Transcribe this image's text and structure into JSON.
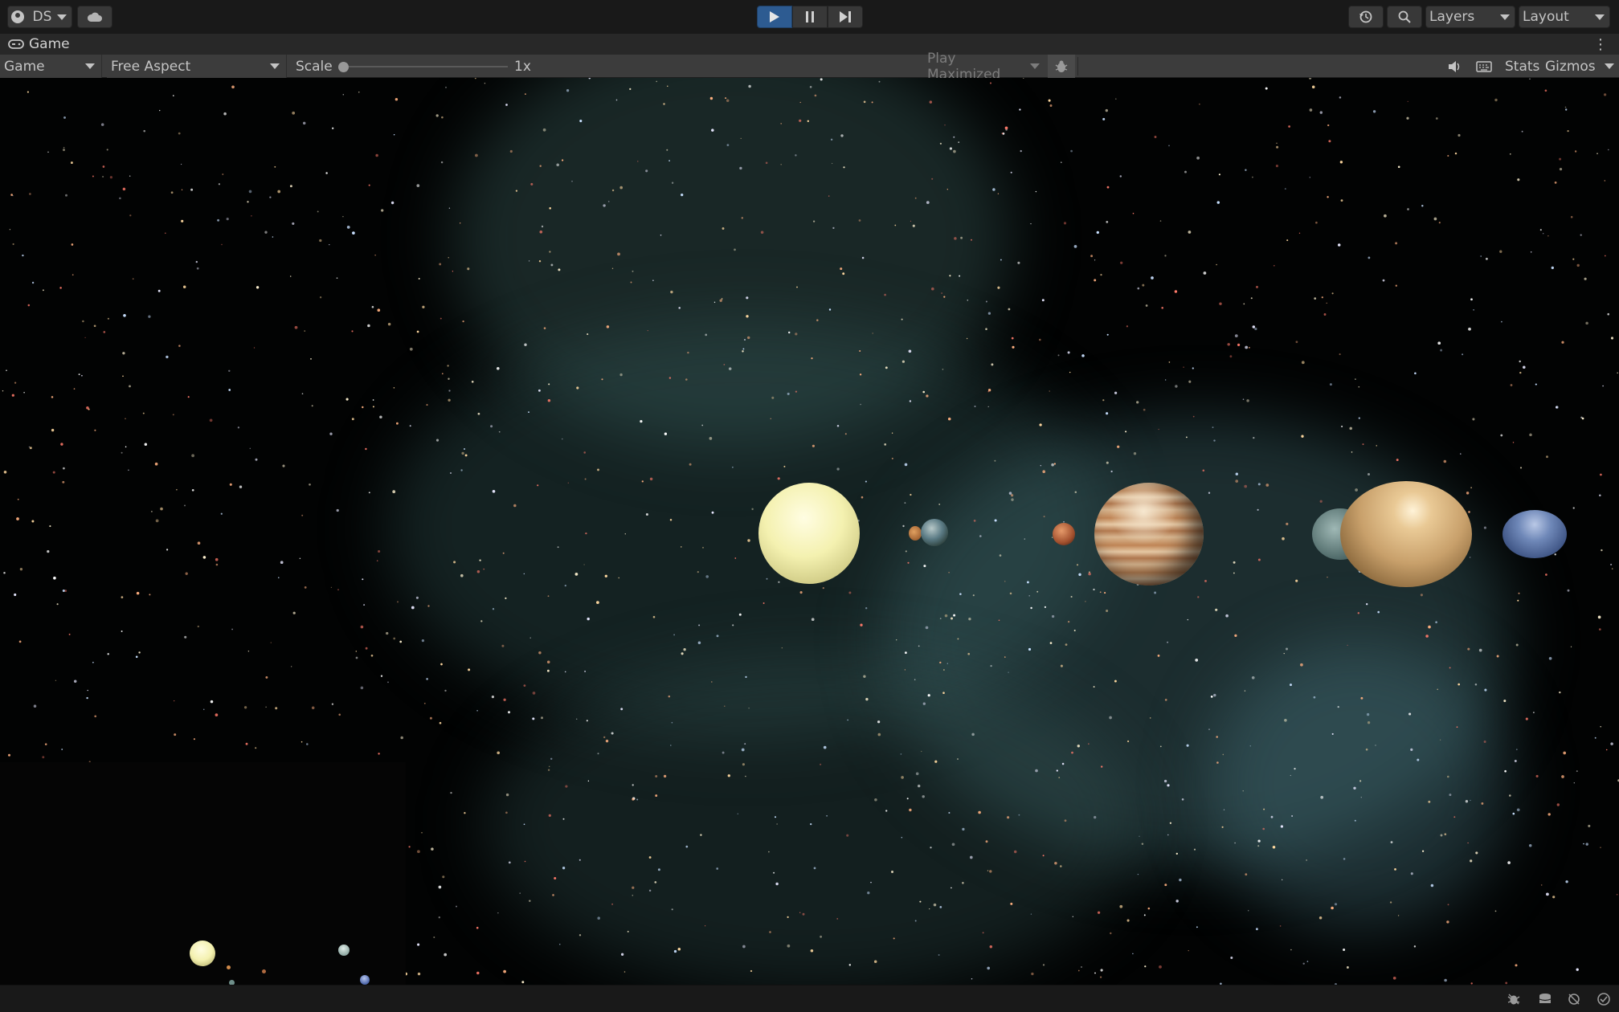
{
  "toolbar": {
    "account_label": "DS",
    "cloud_icon": "cloud-icon",
    "play_icon": "play-icon",
    "pause_icon": "pause-icon",
    "step_icon": "step-icon",
    "history_icon": "history-icon",
    "search_icon": "search-icon",
    "layers_label": "Layers",
    "layout_label": "Layout",
    "accent_color": "#2d5b91"
  },
  "tab": {
    "label": "Game",
    "icon": "gamepad-icon"
  },
  "game_toolbar": {
    "display_label": "Game",
    "aspect_label": "Free Aspect",
    "scale_label": "Scale",
    "scale_value": "1x",
    "play_maximized_label": "Play Maximized",
    "bug_icon": "bug-icon",
    "audio_icon": "speaker-icon",
    "keyboard_icon": "keyboard-icon",
    "stats_label": "Stats",
    "gizmos_label": "Gizmos"
  },
  "scene": {
    "planets": [
      "sun",
      "mercury",
      "earth",
      "mars",
      "jupiter",
      "saturn",
      "neptune"
    ],
    "colors": {
      "sun": "#f6f3b8",
      "jupiter": "#c9a071",
      "saturn": "#d4b07a",
      "neptune": "#5e79a8",
      "mars": "#b06040",
      "nebula": "#3d6a6a"
    }
  },
  "status": {
    "icons": [
      "debug-icon",
      "cache-icon",
      "network-icon",
      "check-icon"
    ]
  }
}
